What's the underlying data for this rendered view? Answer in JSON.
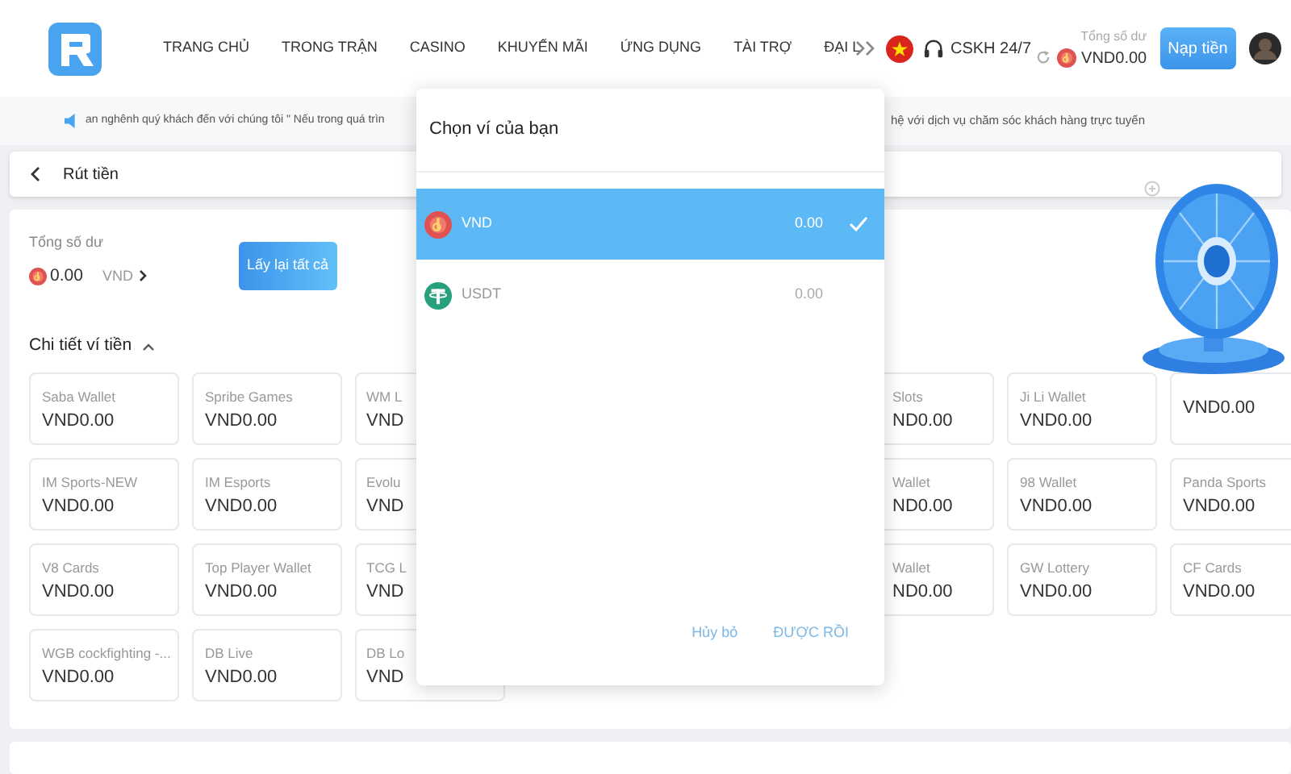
{
  "header": {
    "nav": [
      {
        "label": "TRANG CHỦ"
      },
      {
        "label": "TRONG TRẬN"
      },
      {
        "label": "CASINO"
      },
      {
        "label": "KHUYẾN MÃI"
      },
      {
        "label": "ỨNG DỤNG"
      },
      {
        "label": "TÀI TRỢ"
      },
      {
        "label": "ĐẠI L"
      }
    ],
    "support": "CSKH 24/7",
    "balance_label": "Tổng số dư",
    "balance": "VND0.00",
    "deposit_button": "Nạp tiền"
  },
  "marquee": {
    "left": "an nghênh quý khách đến với chúng tôi \" Nếu trong quá trìn",
    "right": "hệ với dịch vụ chăm sóc khách hàng trực tuyến"
  },
  "page": {
    "title": "Rút tiền"
  },
  "summary": {
    "label": "Tổng số dư",
    "amount": "0.00",
    "currency": "VND",
    "button": "Lấy lại tất cả"
  },
  "wallet_section": {
    "title": "Chi tiết ví tiền",
    "expanded": true
  },
  "wallet_rows": [
    [
      {
        "kind": "full",
        "name": "Saba Wallet",
        "balance": "VND0.00"
      },
      {
        "kind": "full",
        "name": "Spribe Games",
        "balance": "VND0.00"
      },
      {
        "kind": "cut_right",
        "name": "WM L",
        "balance": "VND"
      },
      {
        "kind": "cut_left",
        "name": "Slots",
        "balance": "ND0.00"
      },
      {
        "kind": "full",
        "name": "Ji Li Wallet",
        "balance": "VND0.00"
      },
      {
        "kind": "full",
        "balance": "VND0.00"
      }
    ],
    [
      {
        "kind": "full",
        "name": "IM Sports-NEW",
        "balance": "VND0.00"
      },
      {
        "kind": "full",
        "name": "IM Esports",
        "balance": "VND0.00"
      },
      {
        "kind": "cut_right",
        "name": "Evolu",
        "balance": "VND"
      },
      {
        "kind": "cut_left",
        "name": "Wallet",
        "balance": "ND0.00"
      },
      {
        "kind": "full",
        "name": "98 Wallet",
        "balance": "VND0.00"
      },
      {
        "kind": "full",
        "name": "Panda Sports",
        "balance": "VND0.00"
      }
    ],
    [
      {
        "kind": "full",
        "name": "V8 Cards",
        "balance": "VND0.00"
      },
      {
        "kind": "full",
        "name": "Top Player Wallet",
        "balance": "VND0.00"
      },
      {
        "kind": "cut_right",
        "name": "TCG L",
        "balance": "VND"
      },
      {
        "kind": "cut_left",
        "name": "Wallet",
        "balance": "ND0.00"
      },
      {
        "kind": "full",
        "name": "GW Lottery",
        "balance": "VND0.00"
      },
      {
        "kind": "full",
        "name": "CF Cards",
        "balance": "VND0.00"
      }
    ],
    [
      {
        "kind": "full",
        "name": "WGB cockfighting -...",
        "balance": "VND0.00"
      },
      {
        "kind": "full",
        "name": "DB Live",
        "balance": "VND0.00"
      },
      {
        "kind": "cut_right",
        "name": "DB Lo",
        "balance": "VND"
      }
    ]
  ],
  "modal": {
    "title": "Chọn ví của bạn",
    "options": [
      {
        "kind": "vnd",
        "label": "VND",
        "amount": "0.00",
        "selected": true
      },
      {
        "kind": "usdt",
        "label": "USDT",
        "amount": "0.00",
        "selected": false
      }
    ],
    "cancel": "Hủy bỏ",
    "confirm": "ĐƯỢC RỒI"
  }
}
